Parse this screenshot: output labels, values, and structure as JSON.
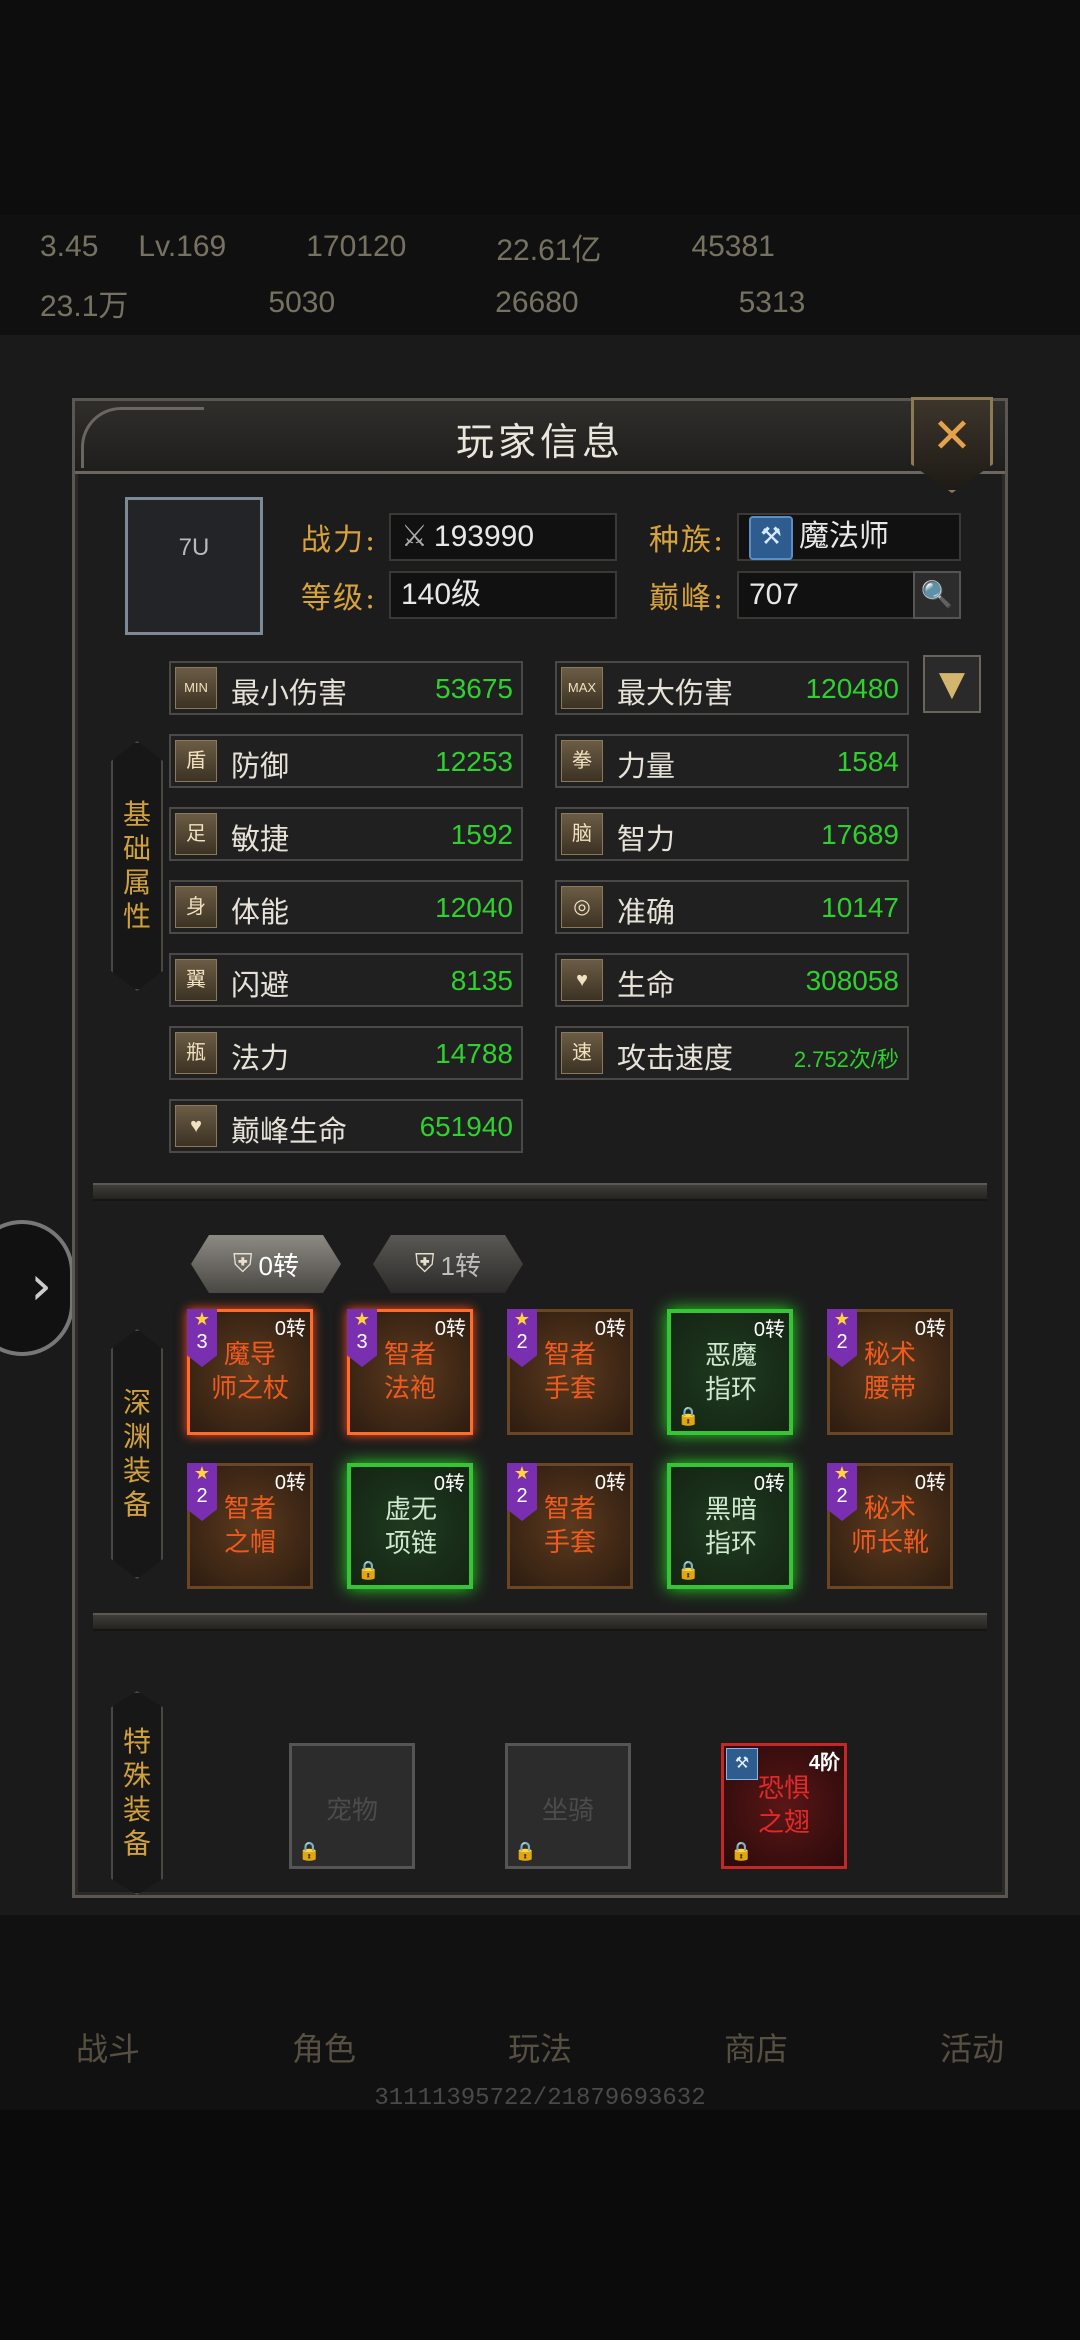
{
  "background": {
    "status_row1": [
      "3.45",
      "Lv.169",
      "170120",
      "22.61亿",
      "45381"
    ],
    "status_row2": [
      "23.1万",
      "5030",
      "26680",
      "5313"
    ],
    "nav": [
      "战斗",
      "角色",
      "玩法",
      "商店",
      "活动"
    ],
    "footer": "31111395722/21879693632"
  },
  "panel": {
    "title": "玩家信息",
    "close_icon": "close-icon"
  },
  "player": {
    "avatar_text": "7U",
    "power_label": "战力:",
    "power_value": "193990",
    "race_label": "种族:",
    "race_value": "魔法师",
    "level_label": "等级:",
    "level_value": "140级",
    "peak_label": "巅峰:",
    "peak_value": "707"
  },
  "sections": {
    "basic": [
      "基",
      "础",
      "属",
      "性"
    ],
    "abyss": [
      "深",
      "渊",
      "装",
      "备"
    ],
    "special": [
      "特",
      "殊",
      "装",
      "备"
    ]
  },
  "stats": [
    {
      "icon": "MIN",
      "name": "最小伤害",
      "value": "53675"
    },
    {
      "icon": "MAX",
      "name": "最大伤害",
      "value": "120480"
    },
    {
      "icon": "盾",
      "name": "防御",
      "value": "12253"
    },
    {
      "icon": "拳",
      "name": "力量",
      "value": "1584"
    },
    {
      "icon": "足",
      "name": "敏捷",
      "value": "1592"
    },
    {
      "icon": "脑",
      "name": "智力",
      "value": "17689"
    },
    {
      "icon": "身",
      "name": "体能",
      "value": "12040"
    },
    {
      "icon": "◎",
      "name": "准确",
      "value": "10147"
    },
    {
      "icon": "翼",
      "name": "闪避",
      "value": "8135"
    },
    {
      "icon": "♥",
      "name": "生命",
      "value": "308058"
    },
    {
      "icon": "瓶",
      "name": "法力",
      "value": "14788"
    },
    {
      "icon": "速",
      "name": "攻击速度",
      "value": "2.752次/秒"
    },
    {
      "icon": "♥",
      "name": "巅峰生命",
      "value": "651940"
    }
  ],
  "turn_tabs": [
    {
      "label": "0转",
      "active": true
    },
    {
      "label": "1转",
      "active": false
    }
  ],
  "abyss_equipment": [
    {
      "name1": "魔导",
      "name2": "师之杖",
      "turn": "0转",
      "stars": "3",
      "type": "orange",
      "selected": true
    },
    {
      "name1": "智者",
      "name2": "法袍",
      "turn": "0转",
      "stars": "3",
      "type": "orange",
      "selected": true
    },
    {
      "name1": "智者",
      "name2": "手套",
      "turn": "0转",
      "stars": "2",
      "type": "orange",
      "selected": false
    },
    {
      "name1": "恶魔",
      "name2": "指环",
      "turn": "0转",
      "stars": "",
      "type": "green",
      "selected": false
    },
    {
      "name1": "秘术",
      "name2": "腰带",
      "turn": "0转",
      "stars": "2",
      "type": "orange",
      "selected": false
    },
    {
      "name1": "智者",
      "name2": "之帽",
      "turn": "0转",
      "stars": "2",
      "type": "orange",
      "selected": false
    },
    {
      "name1": "虚无",
      "name2": "项链",
      "turn": "0转",
      "stars": "",
      "type": "green",
      "selected": false
    },
    {
      "name1": "智者",
      "name2": "手套",
      "turn": "0转",
      "stars": "2",
      "type": "orange",
      "selected": false
    },
    {
      "name1": "黑暗",
      "name2": "指环",
      "turn": "0转",
      "stars": "",
      "type": "green",
      "selected": false
    },
    {
      "name1": "秘术",
      "name2": "师长靴",
      "turn": "0转",
      "stars": "2",
      "type": "orange",
      "selected": false
    }
  ],
  "special_equipment": [
    {
      "name1": "宠物",
      "name2": "",
      "tier": ""
    },
    {
      "name1": "坐骑",
      "name2": "",
      "tier": ""
    },
    {
      "name1": "恐惧",
      "name2": "之翅",
      "tier": "4阶"
    }
  ],
  "colors": {
    "gold_label": "#d6a23c",
    "stat_green": "#2fd12f",
    "orange_item": "#f05a1e",
    "green_glow": "#35c535",
    "red_item": "#c62626"
  }
}
